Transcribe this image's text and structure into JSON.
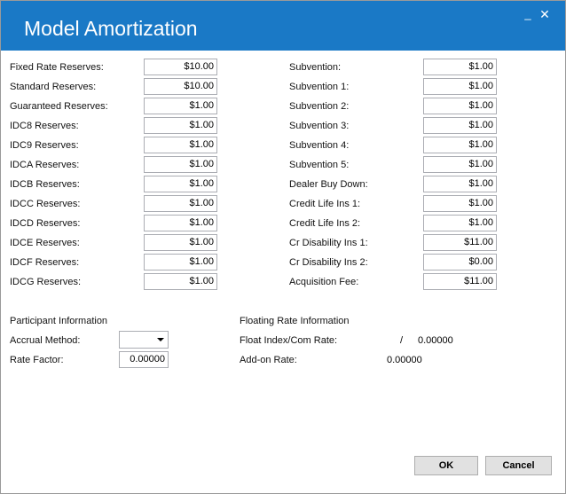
{
  "window": {
    "title": "Model Amortization",
    "minimize_glyph": "_",
    "close_glyph": "✕"
  },
  "reserves_left": [
    {
      "label": "Fixed Rate Reserves:",
      "value": "$10.00"
    },
    {
      "label": "Standard Reserves:",
      "value": "$10.00"
    },
    {
      "label": "Guaranteed Reserves:",
      "value": "$1.00"
    },
    {
      "label": "IDC8 Reserves:",
      "value": "$1.00"
    },
    {
      "label": "IDC9 Reserves:",
      "value": "$1.00"
    },
    {
      "label": "IDCA Reserves:",
      "value": "$1.00"
    },
    {
      "label": "IDCB Reserves:",
      "value": "$1.00"
    },
    {
      "label": "IDCC Reserves:",
      "value": "$1.00"
    },
    {
      "label": "IDCD Reserves:",
      "value": "$1.00"
    },
    {
      "label": "IDCE Reserves:",
      "value": "$1.00"
    },
    {
      "label": "IDCF Reserves:",
      "value": "$1.00"
    },
    {
      "label": "IDCG Reserves:",
      "value": "$1.00"
    }
  ],
  "reserves_right": [
    {
      "label": "Subvention:",
      "value": "$1.00"
    },
    {
      "label": "Subvention 1:",
      "value": "$1.00"
    },
    {
      "label": "Subvention 2:",
      "value": "$1.00"
    },
    {
      "label": "Subvention 3:",
      "value": "$1.00"
    },
    {
      "label": "Subvention 4:",
      "value": "$1.00"
    },
    {
      "label": "Subvention 5:",
      "value": "$1.00"
    },
    {
      "label": "Dealer Buy Down:",
      "value": "$1.00"
    },
    {
      "label": "Credit Life Ins 1:",
      "value": "$1.00"
    },
    {
      "label": "Credit Life Ins 2:",
      "value": "$1.00"
    },
    {
      "label": "Cr Disability Ins 1:",
      "value": "$11.00"
    },
    {
      "label": "Cr Disability Ins 2:",
      "value": "$0.00"
    },
    {
      "label": "Acquisition Fee:",
      "value": "$11.00"
    }
  ],
  "participant": {
    "heading": "Participant Information",
    "accrual_label": "Accrual Method:",
    "accrual_value": "",
    "rate_factor_label": "Rate Factor:",
    "rate_factor_value": "0.00000"
  },
  "floating": {
    "heading": "Floating Rate Information",
    "float_index_label": "Float Index/Com Rate:",
    "float_index_sep": "/",
    "float_index_value": "0.00000",
    "addon_label": "Add-on Rate:",
    "addon_value": "0.00000"
  },
  "buttons": {
    "ok": "OK",
    "cancel": "Cancel"
  },
  "colors": {
    "titlebar": "#1a79c6"
  }
}
